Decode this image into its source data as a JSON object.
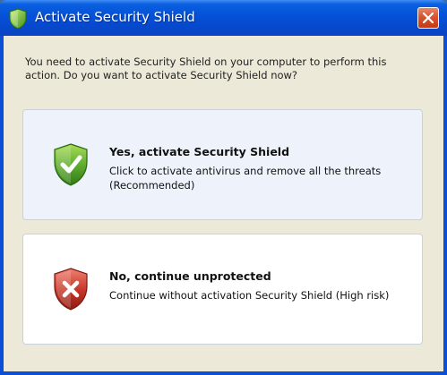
{
  "window": {
    "title": "Activate Security Shield",
    "close_icon": "close-icon"
  },
  "message": "You need to activate Security Shield on your computer to perform this action. Do you want to activate Security Shield now?",
  "options": [
    {
      "title": "Yes, activate Security Shield",
      "description": "Click to activate antivirus and remove all the threats (Recommended)",
      "icon": "green-shield-check-icon",
      "color": "#4a9a2a"
    },
    {
      "title": "No, continue unprotected",
      "description": "Continue without activation Security Shield (High risk)",
      "icon": "red-shield-x-icon",
      "color": "#c23a2a"
    }
  ],
  "colors": {
    "titlebar": "#0553d8",
    "client_bg": "#ece9d8",
    "close_button": "#d9532f"
  }
}
